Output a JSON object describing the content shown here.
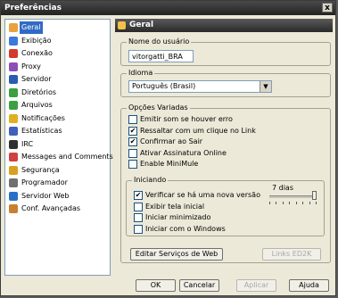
{
  "window": {
    "title": "Preferências",
    "close": "x"
  },
  "sidebar": {
    "items": [
      {
        "label": "Geral",
        "icon": "general-icon",
        "color": "#e8a23a"
      },
      {
        "label": "Exibição",
        "icon": "display-icon",
        "color": "#3a7bd5"
      },
      {
        "label": "Conexão",
        "icon": "connection-icon",
        "color": "#d43a2a"
      },
      {
        "label": "Proxy",
        "icon": "proxy-icon",
        "color": "#8c4fb8"
      },
      {
        "label": "Servidor",
        "icon": "server-icon",
        "color": "#2a5db0"
      },
      {
        "label": "Diretórios",
        "icon": "folder-icon",
        "color": "#3aa040"
      },
      {
        "label": "Arquivos",
        "icon": "files-icon",
        "color": "#3aa040"
      },
      {
        "label": "Notificações",
        "icon": "notification-icon",
        "color": "#e0b020"
      },
      {
        "label": "Estatísticas",
        "icon": "statistics-icon",
        "color": "#4060c0"
      },
      {
        "label": "IRC",
        "icon": "irc-icon",
        "color": "#303030"
      },
      {
        "label": "Messages and Comments",
        "icon": "messages-icon",
        "color": "#d04040"
      },
      {
        "label": "Segurança",
        "icon": "security-icon",
        "color": "#d8a020"
      },
      {
        "label": "Programador",
        "icon": "scheduler-icon",
        "color": "#707070"
      },
      {
        "label": "Servidor Web",
        "icon": "webserver-icon",
        "color": "#2a70c8"
      },
      {
        "label": "Conf. Avançadas",
        "icon": "advanced-icon",
        "color": "#c88030"
      }
    ]
  },
  "panel": {
    "title": "Geral",
    "username": {
      "label": "Nome do usuário",
      "value": "vitorgatti_BRA"
    },
    "language": {
      "label": "Idioma",
      "value": "Português (Brasil)"
    },
    "options": {
      "label": "Opções Variadas",
      "items": [
        {
          "label": "Emitir som se houver erro",
          "checked": false
        },
        {
          "label": "Ressaltar com um clique no Link",
          "checked": true
        },
        {
          "label": "Confirmar ao Sair",
          "checked": true
        },
        {
          "label": "Ativar Assinatura Online",
          "checked": false
        },
        {
          "label": "Enable MiniMule",
          "checked": false
        }
      ]
    },
    "startup": {
      "label": "Iniciando",
      "days_label": "7 dias",
      "days_value": 7,
      "items": [
        {
          "label": "Verificar se há uma nova versão",
          "checked": true
        },
        {
          "label": "Exibir tela inicial",
          "checked": false
        },
        {
          "label": "Iniciar minimizado",
          "checked": false
        },
        {
          "label": "Iniciar com o Windows",
          "checked": false
        }
      ]
    },
    "edit_services": "Editar Serviços de Web",
    "ed2k_links": "Links ED2K"
  },
  "footer": {
    "ok": "OK",
    "cancel": "Cancelar",
    "apply": "Aplicar",
    "help": "Ajuda"
  },
  "check_mark": "✔"
}
